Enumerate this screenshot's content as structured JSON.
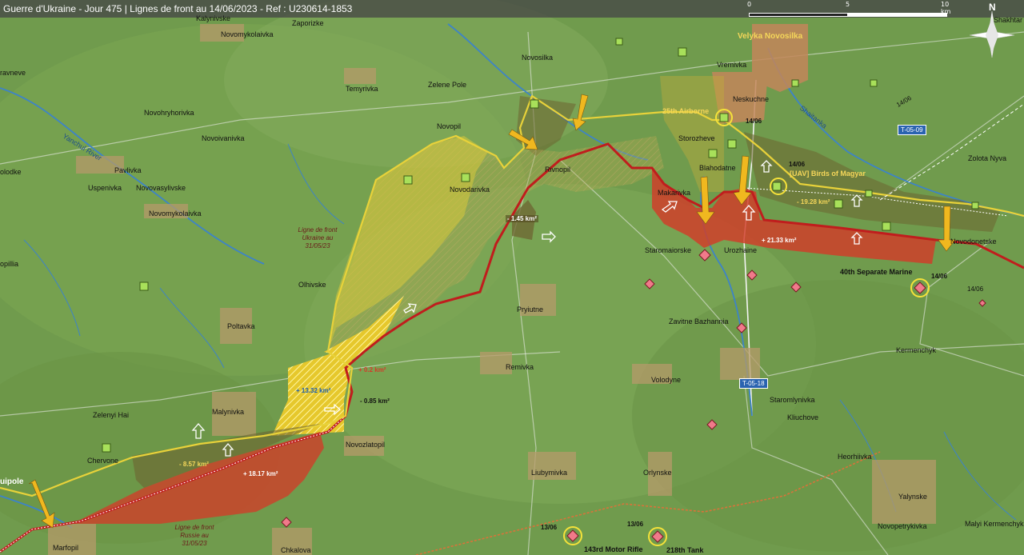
{
  "header": {
    "title": "Guerre d'Ukraine - Jour 475 | Lignes de front au 14/06/2023 - Ref : U230614-1853"
  },
  "scale": {
    "l0": "0",
    "l5": "5",
    "l10": "10 km"
  },
  "compass": {
    "north": "N"
  },
  "colors": {
    "red_zone": "#d2402b",
    "yellow_zone": "#dccc2a",
    "russian_line": "#c22020",
    "ukrainian_line": "#e8d23a",
    "arrow": "#f0b81f",
    "ua_unit": "#a8e05a",
    "ru_unit": "#f07a8a"
  },
  "places": [
    {
      "id": "kalynivske",
      "text": "Kalynivske"
    },
    {
      "id": "zaporizke",
      "text": "Zaporizke"
    },
    {
      "id": "novomykolaivka1",
      "text": "Novomykolaivka"
    },
    {
      "id": "zelene-pole",
      "text": "Zelene Pole"
    },
    {
      "id": "novosilka",
      "text": "Novosilka"
    },
    {
      "id": "temyrivka",
      "text": "Temyrivka"
    },
    {
      "id": "novohryhorivka",
      "text": "Novohryhorivka"
    },
    {
      "id": "novoivanivka",
      "text": "Novoivanivka"
    },
    {
      "id": "novopil",
      "text": "Novopil"
    },
    {
      "id": "rivnopil",
      "text": "Rivnopil"
    },
    {
      "id": "novodarivka",
      "text": "Novodarivka"
    },
    {
      "id": "pavlivka",
      "text": "Pavlivka"
    },
    {
      "id": "uspenivka",
      "text": "Uspenivka"
    },
    {
      "id": "novovasylivske",
      "text": "Novovasylivske"
    },
    {
      "id": "novomykolaivka2",
      "text": "Novomykolaivka"
    },
    {
      "id": "olhivske",
      "text": "Olhivske"
    },
    {
      "id": "poltavka",
      "text": "Poltavka"
    },
    {
      "id": "pryiutne",
      "text": "Pryiutne"
    },
    {
      "id": "remivka",
      "text": "Remivka"
    },
    {
      "id": "volodyne",
      "text": "Volodyne"
    },
    {
      "id": "malynivka",
      "text": "Malynivka"
    },
    {
      "id": "zelenyi-hai",
      "text": "Zelenyi Hai"
    },
    {
      "id": "chervone",
      "text": "Chervone"
    },
    {
      "id": "novozlatopil",
      "text": "Novozlatopil"
    },
    {
      "id": "liubymivka",
      "text": "Liubymivka"
    },
    {
      "id": "orlynske",
      "text": "Orlynske"
    },
    {
      "id": "marfopil",
      "text": "Marfopil"
    },
    {
      "id": "chkalova",
      "text": "Chkalova"
    },
    {
      "id": "huliaipole",
      "text": "uipole"
    },
    {
      "id": "velyka-novosilka",
      "text": "Velyka Novosilka"
    },
    {
      "id": "vremivka",
      "text": "Vremivka"
    },
    {
      "id": "neskuchne",
      "text": "Neskuchne"
    },
    {
      "id": "storozheve",
      "text": "Storozheve"
    },
    {
      "id": "blahodatne",
      "text": "Blahodatne"
    },
    {
      "id": "makarivka",
      "text": "Makarivka"
    },
    {
      "id": "staromaiorske",
      "text": "Staromaiorske"
    },
    {
      "id": "urozhaine",
      "text": "Urozhaine"
    },
    {
      "id": "novodonetske",
      "text": "Novodonetske"
    },
    {
      "id": "zavitne-bazhannia",
      "text": "Zavitne Bazhannia"
    },
    {
      "id": "kermenchyk",
      "text": "Kermenchyk"
    },
    {
      "id": "staromlynivka",
      "text": "Staromlynivka"
    },
    {
      "id": "kliuchove",
      "text": "Kliuchove"
    },
    {
      "id": "heorhiivka",
      "text": "Heorhiivka"
    },
    {
      "id": "yalynske",
      "text": "Yalynske"
    },
    {
      "id": "novopetrykivka",
      "text": "Novopetrykivka"
    },
    {
      "id": "malyi-kermenchyk",
      "text": "Malyi Kermenchyk"
    },
    {
      "id": "zolota-nyva",
      "text": "Zolota Nyva"
    },
    {
      "id": "shakhtarske",
      "text": "Shakhtar"
    },
    {
      "id": "pillia",
      "text": "opillia"
    },
    {
      "id": "olodke",
      "text": "olodke"
    },
    {
      "id": "ravneve",
      "text": "ravneve"
    }
  ],
  "rivers": {
    "yanchul": "Yanchul River",
    "shaitanka": "Shaitanka"
  },
  "roads": {
    "t0509": "T-05-09",
    "t0518": "T-05-18",
    "t1406": "14/06"
  },
  "units": {
    "ua_25_airborne": "25th Airborne",
    "ua_birds_magyar": "[UAV] Birds of Magyar",
    "ru_40_marine": "40th Separate Marine",
    "ru_143_motor_rifle": "143rd Motor Rifle",
    "ru_218_tank": "218th Tank"
  },
  "dates": {
    "d_airborne": "14/06",
    "d_magyar": "14/06",
    "d_marine": "14/06",
    "d_marine2": "14/06",
    "d_143": "13/06",
    "d_218": "13/06"
  },
  "areas": {
    "a1": "- 1.45 km²",
    "a2": "- 19.28 km²",
    "a3": "+ 21.33 km²",
    "a4": "+ 0.2 km²",
    "a5": "+ 13.32 km²",
    "a6": "- 0.85 km²",
    "a7": "- 8.57 km²",
    "a8": "+ 18.17 km²"
  },
  "annotations": {
    "ukraine_line": [
      "Ligne de front",
      "Ukraine au",
      "31/05/23"
    ],
    "russia_line": [
      "Ligne de front",
      "Russie au",
      "31/05/23"
    ]
  }
}
